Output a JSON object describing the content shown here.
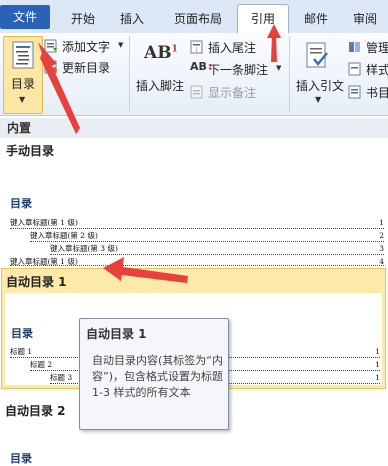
{
  "tabs": {
    "file": "文件",
    "home": "开始",
    "insert": "插入",
    "layout": "页面布局",
    "references": "引用",
    "mailings": "邮件",
    "review": "审阅"
  },
  "ribbon": {
    "toc_button": "目录",
    "add_text": "添加文字",
    "update_toc": "更新目录",
    "insert_footnote": "插入脚注",
    "insert_endnote": "插入尾注",
    "next_footnote": "下一条脚注",
    "show_notes": "显示备注",
    "insert_citation": "插入引文",
    "manage": "管理",
    "style": "样式",
    "bibliography": "书目",
    "ab_label": "AB",
    "ab_sup": "1"
  },
  "gallery": {
    "builtin_header": "内置",
    "manual_toc": {
      "title": "手动目录",
      "heading": "目录",
      "lines": [
        {
          "text": "键入章标题(第 1 级)",
          "page": "1"
        },
        {
          "text": "键入章标题(第 2 级)",
          "page": "2"
        },
        {
          "text": "键入章标题(第 3 级)",
          "page": "3"
        },
        {
          "text": "键入章标题(第 1 级)",
          "page": "4"
        }
      ]
    },
    "auto_toc1": {
      "title": "自动目录 1",
      "heading": "目录",
      "lines": [
        {
          "text": "标题 1",
          "page": "1"
        },
        {
          "text": "标题 2",
          "page": "1"
        },
        {
          "text": "标题 3",
          "page": "1"
        }
      ]
    },
    "auto_toc2": {
      "title": "自动目录 2",
      "heading": "目录"
    }
  },
  "tooltip": {
    "title": "自动目录 1",
    "body": "自动目录内容(其标签为“内容”)，包含格式设置为标题 1-3 样式的所有文本"
  },
  "colors": {
    "accent_arrow": "#e8403a",
    "file_tab": "#2a62b8",
    "selected_item": "#fdeaa9"
  }
}
